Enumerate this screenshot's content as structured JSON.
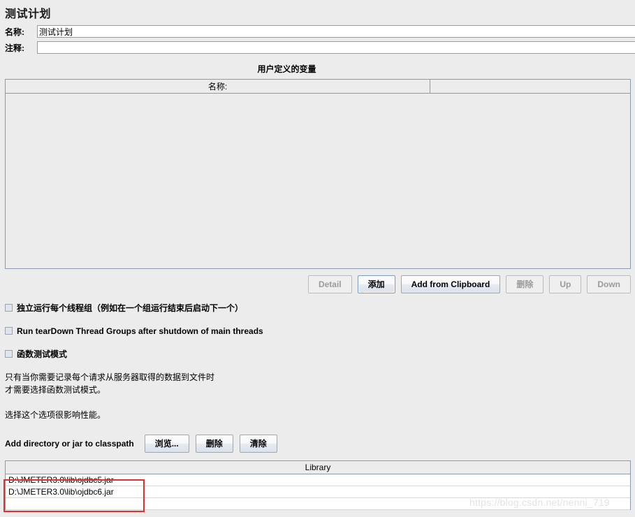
{
  "page": {
    "title": "测试计划"
  },
  "fields": {
    "name_label": "名称:",
    "name_value": "测试计划",
    "comment_label": "注释:",
    "comment_value": ""
  },
  "user_defined_variables": {
    "section_title": "用户定义的变量",
    "columns": [
      "名称:",
      ""
    ],
    "rows": []
  },
  "variable_buttons": {
    "detail": "Detail",
    "add": "添加",
    "add_from_clipboard": "Add from Clipboard",
    "delete": "删除",
    "up": "Up",
    "down": "Down"
  },
  "options": [
    {
      "label": "独立运行每个线程组（例如在一个组运行结束后启动下一个）",
      "checked": false
    },
    {
      "label": "Run tearDown Thread Groups after shutdown of main threads",
      "checked": false
    },
    {
      "label": "函数测试模式",
      "checked": false
    }
  ],
  "description": {
    "line1": "只有当你需要记录每个请求从服务器取得的数据到文件时",
    "line2": "才需要选择函数测试模式。",
    "line3": "选择这个选项很影响性能。"
  },
  "classpath": {
    "label": "Add directory or jar to classpath",
    "browse": "浏览...",
    "delete": "删除",
    "clear": "清除"
  },
  "library_table": {
    "header": "Library",
    "rows": [
      "D:\\JMETER3.0\\lib\\ojdbc5.jar",
      "D:\\JMETER3.0\\lib\\ojdbc6.jar"
    ]
  },
  "watermark": {
    "text": "https://blog.csdn.net/nenni_719"
  },
  "colors": {
    "background": "#ececec",
    "border": "#8c9cae",
    "annotation": "#e03030",
    "disabled_text": "#9b9b9b"
  }
}
